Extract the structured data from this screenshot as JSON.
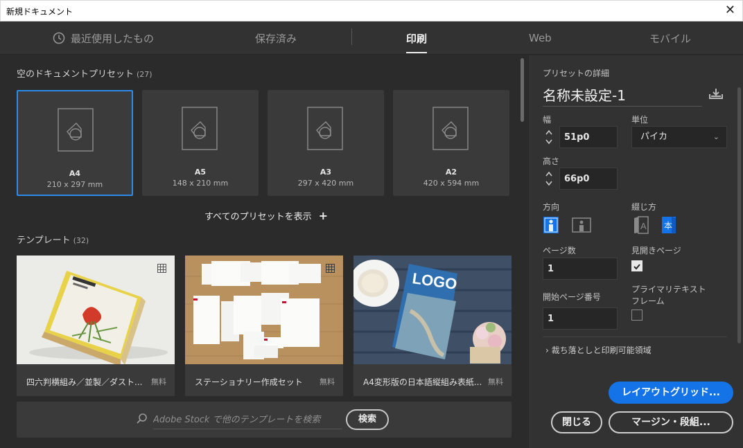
{
  "window": {
    "title": "新規ドキュメント",
    "close_symbol": "✕"
  },
  "tabs": [
    {
      "label": "最近使用したもの",
      "icon": "clock-icon"
    },
    {
      "label": "保存済み"
    },
    {
      "label": "印刷",
      "active": true
    },
    {
      "label": "Web"
    },
    {
      "label": "モバイル"
    }
  ],
  "presets": {
    "title": "空のドキュメントプリセット",
    "count": "(27)",
    "items": [
      {
        "name": "A4",
        "size": "210 x 297 mm",
        "selected": true
      },
      {
        "name": "A5",
        "size": "148 x 210 mm"
      },
      {
        "name": "A3",
        "size": "297 x 420 mm"
      },
      {
        "name": "A2",
        "size": "420 x 594 mm"
      }
    ],
    "show_all": "すべてのプリセットを表示",
    "show_all_symbol": "+"
  },
  "templates": {
    "title": "テンプレート",
    "count": "(32)",
    "items": [
      {
        "name": "四六判横組み／並製／ダスト...",
        "price": "無料"
      },
      {
        "name": "ステーショナリー作成セット",
        "price": "無料"
      },
      {
        "name": "A4変形版の日本語縦組み表紙...",
        "price": "無料"
      }
    ]
  },
  "search": {
    "placeholder": "Adobe Stock で他のテンプレートを検索",
    "button": "検索"
  },
  "details": {
    "header": "プリセットの詳細",
    "doc_name": "名称未設定-1",
    "width_label": "幅",
    "width_value": "51p0",
    "unit_label": "単位",
    "unit_value": "パイカ",
    "height_label": "高さ",
    "height_value": "66p0",
    "orientation_label": "方向",
    "binding_label": "綴じ方",
    "pages_label": "ページ数",
    "pages_value": "1",
    "facing_label": "見開きページ",
    "facing_checked": true,
    "start_page_label": "開始ページ番号",
    "start_page_value": "1",
    "primary_frame_label_1": "プライマリテキスト",
    "primary_frame_label_2": "フレーム",
    "primary_frame_checked": false,
    "bleed_label": "裁ち落としと印刷可能領域",
    "bleed_symbol": "›"
  },
  "buttons": {
    "layout_grid": "レイアウトグリッド...",
    "close": "閉じる",
    "margins": "マージン・段組..."
  },
  "colors": {
    "accent": "#1473e6",
    "selected_border": "#2d8ceb"
  }
}
